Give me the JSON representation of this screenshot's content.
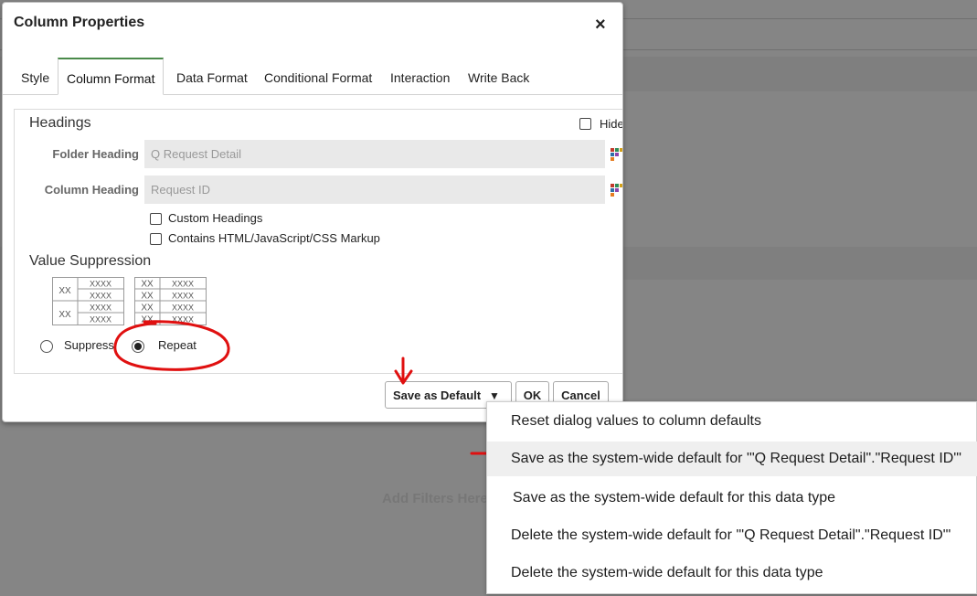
{
  "background": {
    "filter_placeholder": "Add Filters Here"
  },
  "dialog": {
    "title": "Column Properties",
    "close_glyph": "×",
    "tabs": [
      {
        "label": "Style"
      },
      {
        "label": "Column Format",
        "active": true
      },
      {
        "label": "Data Format"
      },
      {
        "label": "Conditional Format"
      },
      {
        "label": "Interaction"
      },
      {
        "label": "Write Back"
      }
    ],
    "headings": {
      "title": "Headings",
      "hide_label": "Hide",
      "hide_checked": false,
      "folder_heading_label": "Folder Heading",
      "folder_heading_value": "Q Request Detail",
      "column_heading_label": "Column Heading",
      "column_heading_value": "Request ID",
      "custom_headings_label": "Custom Headings",
      "custom_headings_checked": false,
      "markup_label": "Contains HTML/JavaScript/CSS Markup",
      "markup_checked": false
    },
    "value_suppression": {
      "title": "Value Suppression",
      "suppress_example": {
        "group": "XX",
        "cell": "XXXX"
      },
      "repeat_example": {
        "group": "XX",
        "cell": "XXXX"
      },
      "options": [
        {
          "label": "Suppress",
          "checked": false
        },
        {
          "label": "Repeat",
          "checked": true
        }
      ]
    },
    "buttons": {
      "save_default": "Save as Default",
      "dropdown_glyph": "▼",
      "ok": "OK",
      "cancel": "Cancel"
    }
  },
  "dropdown_menu": {
    "items": [
      {
        "label": "Reset dialog values to column defaults"
      },
      {
        "label": "Save as the system-wide default for '\"Q Request Detail\".\"Request ID\"'",
        "highlighted": true
      },
      {
        "label": "Save as the system-wide default for this data type"
      },
      {
        "label": "Delete the system-wide default for '\"Q Request Detail\".\"Request ID\"'"
      },
      {
        "label": "Delete the system-wide default for this data type"
      }
    ]
  },
  "colors": {
    "active_tab_accent": "#4a8a4a",
    "annotation_red": "#e01010",
    "overlay": "rgba(0,0,0,0.44)"
  },
  "icons": [
    "close-icon",
    "column-format-icon",
    "dropdown-arrow-icon"
  ]
}
